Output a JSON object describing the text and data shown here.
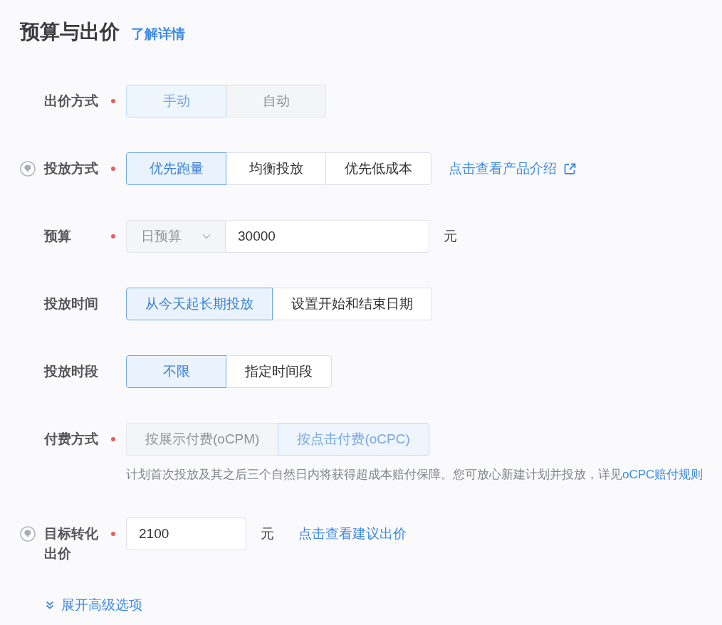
{
  "section": {
    "title": "预算与出价",
    "link": "了解详情"
  },
  "fields": [
    {
      "kind": "segmented",
      "label": "出价方式",
      "required": true,
      "help": false,
      "options": [
        {
          "label": "手动",
          "selected": true,
          "disabled": true
        },
        {
          "label": "自动",
          "selected": false,
          "disabled": true
        }
      ]
    },
    {
      "kind": "segmented",
      "label": "投放方式",
      "required": true,
      "help": true,
      "options": [
        {
          "label": "优先跑量",
          "selected": true,
          "disabled": false
        },
        {
          "label": "均衡投放",
          "selected": false,
          "disabled": false
        },
        {
          "label": "优先低成本",
          "selected": false,
          "disabled": false
        }
      ],
      "link": "点击查看产品介绍"
    },
    {
      "kind": "budget",
      "label": "预算",
      "required": true,
      "help": false,
      "select": {
        "value": "日预算",
        "disabled": true
      },
      "value": "30000",
      "unit": "元"
    },
    {
      "kind": "segmented",
      "label": "投放时间",
      "required": false,
      "help": false,
      "options": [
        {
          "label": "从今天起长期投放",
          "selected": true,
          "disabled": false
        },
        {
          "label": "设置开始和结束日期",
          "selected": false,
          "disabled": false
        }
      ]
    },
    {
      "kind": "segmented",
      "label": "投放时段",
      "required": false,
      "help": false,
      "options": [
        {
          "label": "不限",
          "selected": true,
          "disabled": false
        },
        {
          "label": "指定时间段",
          "selected": false,
          "disabled": false
        }
      ]
    },
    {
      "kind": "segmented",
      "label": "付费方式",
      "required": true,
      "help": false,
      "options": [
        {
          "label": "按展示付费(oCPM)",
          "selected": false,
          "disabled": true
        },
        {
          "label": "按点击付费(oCPC)",
          "selected": true,
          "disabled": true
        }
      ],
      "note": "计划首次投放及其之后三个自然日内将获得超成本赔付保障。您可放心新建计划并投放，详见",
      "note_link": "oCPC赔付规则"
    },
    {
      "kind": "amount",
      "label": "目标转化出价",
      "required": true,
      "help": true,
      "value": "2100",
      "unit": "元",
      "link": "点击查看建议出价"
    }
  ],
  "expand_link": "展开高级选项"
}
